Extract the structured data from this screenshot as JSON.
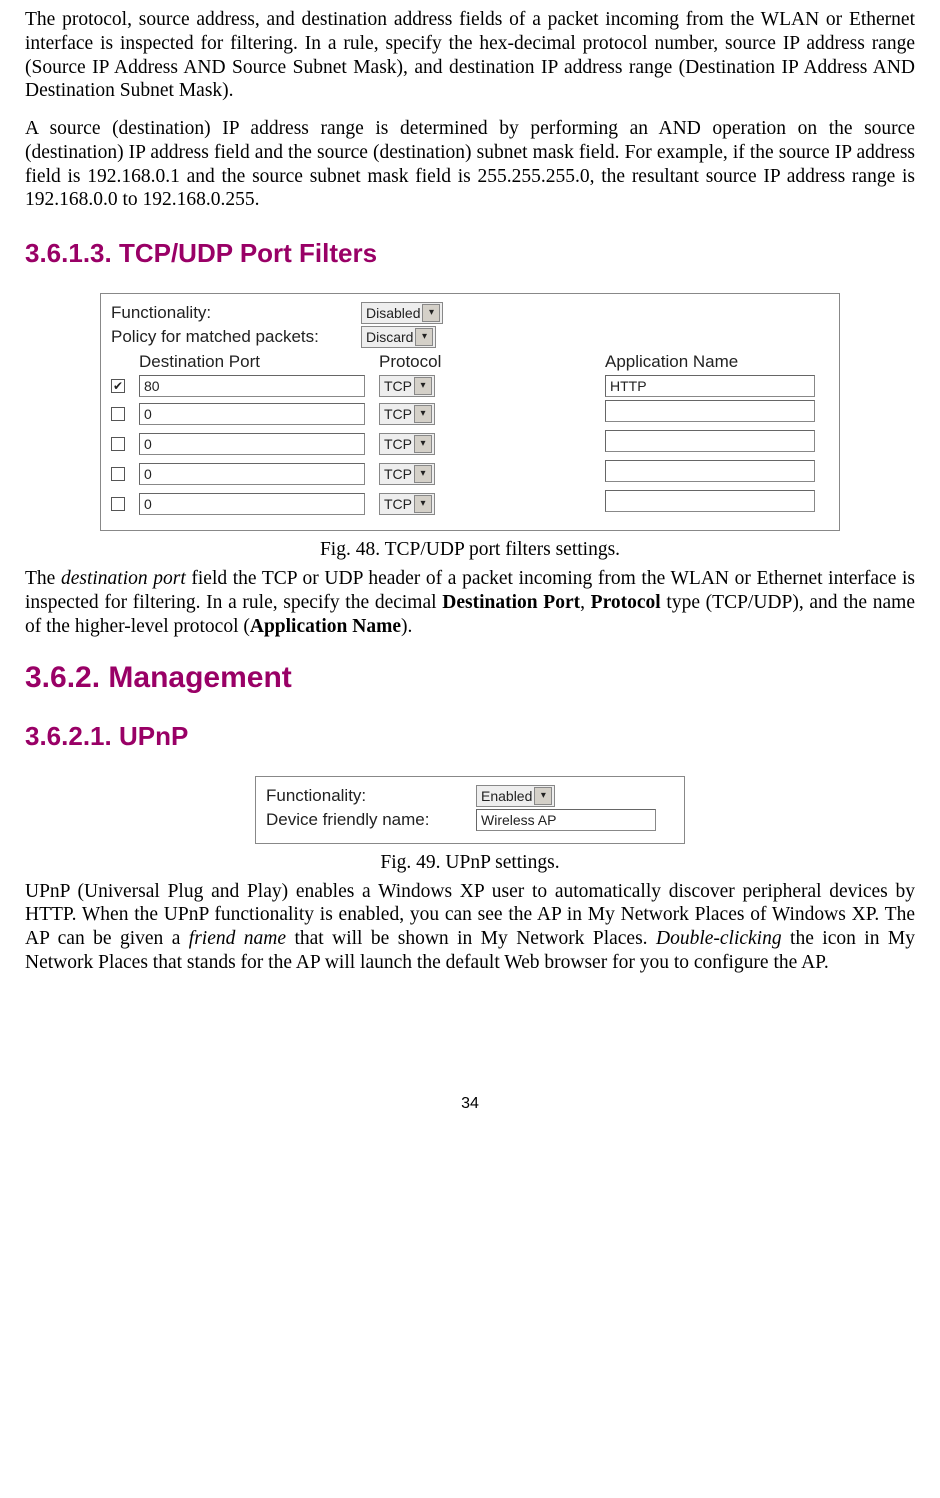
{
  "intro": {
    "p1": "The protocol, source address, and destination address fields of a packet incoming from the WLAN or Ethernet interface is inspected for filtering. In a rule, specify the hex-decimal protocol number, source IP address range (Source IP Address AND Source Subnet Mask), and destination IP address range (Destination IP Address AND Destination Subnet Mask).",
    "p2": "A source (destination) IP address range is determined by performing an AND operation on the source (destination) IP address field and the source (destination) subnet mask field. For example, if the source IP address field is 192.168.0.1 and the source subnet mask field is 255.255.255.0, the resultant source IP address range is 192.168.0.0 to 192.168.0.255."
  },
  "sec1": {
    "heading": "3.6.1.3. TCP/UDP Port Filters",
    "caption": "Fig. 48. TCP/UDP port filters settings.",
    "p_a": "The ",
    "p_dest_port": "destination port",
    "p_b": " field the TCP or UDP header of a packet incoming from the WLAN or Ethernet interface is inspected for filtering. In a rule, specify the decimal ",
    "p_bold1": "Destination Port",
    "p_c": ", ",
    "p_bold2": "Protocol",
    "p_d": " type (TCP/UDP), and the name of the higher-level protocol (",
    "p_bold3": "Application Name",
    "p_e": ")."
  },
  "panel1": {
    "functionality_label": "Functionality:",
    "functionality_value": "Disabled",
    "policy_label": "Policy for matched packets:",
    "policy_value": "Discard",
    "header_dest": "Destination Port",
    "header_proto": "Protocol",
    "header_app": "Application Name",
    "rows": [
      {
        "checked": true,
        "port": "80",
        "proto": "TCP",
        "app": "HTTP"
      },
      {
        "checked": false,
        "port": "0",
        "proto": "TCP",
        "app": ""
      },
      {
        "checked": false,
        "port": "0",
        "proto": "TCP",
        "app": ""
      },
      {
        "checked": false,
        "port": "0",
        "proto": "TCP",
        "app": ""
      },
      {
        "checked": false,
        "port": "0",
        "proto": "TCP",
        "app": ""
      }
    ]
  },
  "sec2": {
    "heading_mgmt": "3.6.2. Management",
    "heading_upnp": "3.6.2.1. UPnP",
    "caption": "Fig. 49. UPnP settings.",
    "p_a": "UPnP (Universal Plug and Play) enables a Windows XP user to automatically discover peripheral devices by HTTP. When the UPnP functionality is enabled, you can see the AP in My Network Places of Windows XP. The AP can be given a ",
    "p_italic1": "friend name",
    "p_b": " that will be shown in My Network Places. ",
    "p_italic2": "Double-clicking",
    "p_c": " the icon in My Network Places that stands for the AP will launch the default Web browser for you to configure the AP."
  },
  "panel2": {
    "functionality_label": "Functionality:",
    "functionality_value": "Enabled",
    "name_label": "Device friendly name:",
    "name_value": "Wireless AP"
  },
  "page_number": "34"
}
